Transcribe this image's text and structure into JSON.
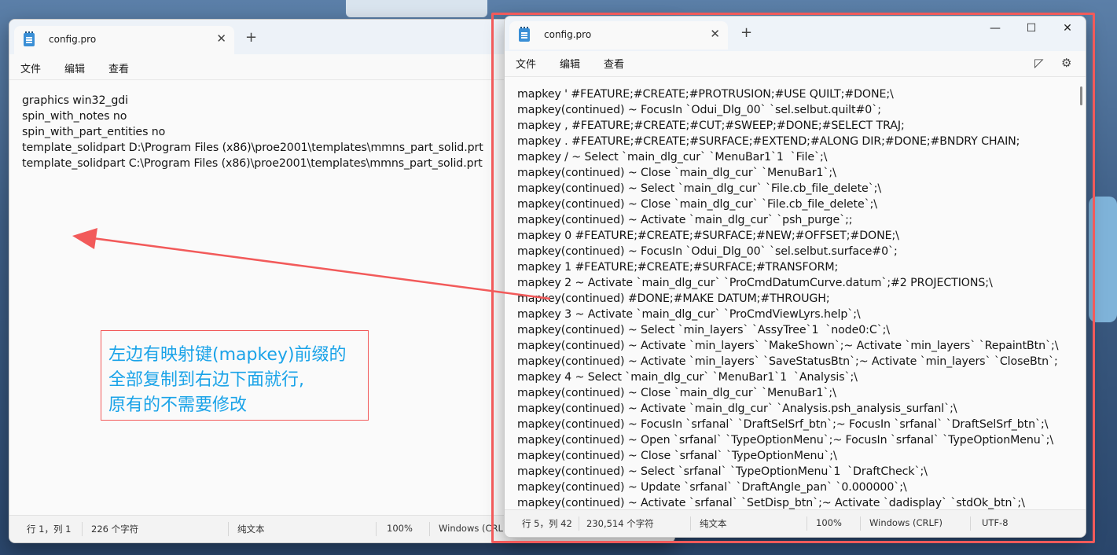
{
  "left_window": {
    "tab_title": "config.pro",
    "menu": [
      "文件",
      "编辑",
      "查看"
    ],
    "lines": [
      "graphics win32_gdi",
      "spin_with_notes no",
      "spin_with_part_entities no",
      "template_solidpart D:\\Program Files (x86)\\proe2001\\templates\\mmns_part_solid.prt",
      "template_solidpart C:\\Program Files (x86)\\proe2001\\templates\\mmns_part_solid.prt"
    ],
    "status": {
      "position": "行 1，列 1",
      "chars": "226 个字符",
      "format": "纯文本",
      "zoom": "100%",
      "line_ending": "Windows (CRLF)"
    }
  },
  "right_window": {
    "tab_title": "config.pro",
    "menu": [
      "文件",
      "编辑",
      "查看"
    ],
    "lines": [
      "mapkey ' #FEATURE;#CREATE;#PROTRUSION;#USE QUILT;#DONE;\\",
      "mapkey(continued) ~ FocusIn `Odui_Dlg_00` `sel.selbut.quilt#0`;",
      "mapkey , #FEATURE;#CREATE;#CUT;#SWEEP;#DONE;#SELECT TRAJ;",
      "mapkey . #FEATURE;#CREATE;#SURFACE;#EXTEND;#ALONG DIR;#DONE;#BNDRY CHAIN;",
      "mapkey / ~ Select `main_dlg_cur` `MenuBar1`1  `File`;\\",
      "mapkey(continued) ~ Close `main_dlg_cur` `MenuBar1`;\\",
      "mapkey(continued) ~ Select `main_dlg_cur` `File.cb_file_delete`;\\",
      "mapkey(continued) ~ Close `main_dlg_cur` `File.cb_file_delete`;\\",
      "mapkey(continued) ~ Activate `main_dlg_cur` `psh_purge`;;",
      "mapkey 0 #FEATURE;#CREATE;#SURFACE;#NEW;#OFFSET;#DONE;\\",
      "mapkey(continued) ~ FocusIn `Odui_Dlg_00` `sel.selbut.surface#0`;",
      "mapkey 1 #FEATURE;#CREATE;#SURFACE;#TRANSFORM;",
      "mapkey 2 ~ Activate `main_dlg_cur` `ProCmdDatumCurve.datum`;#2 PROJECTIONS;\\",
      "mapkey(continued) #DONE;#MAKE DATUM;#THROUGH;",
      "mapkey 3 ~ Activate `main_dlg_cur` `ProCmdViewLyrs.help`;\\",
      "mapkey(continued) ~ Select `min_layers` `AssyTree`1  `node0:C`;\\",
      "mapkey(continued) ~ Activate `min_layers` `MakeShown`;~ Activate `min_layers` `RepaintBtn`;\\",
      "mapkey(continued) ~ Activate `min_layers` `SaveStatusBtn`;~ Activate `min_layers` `CloseBtn`;",
      "mapkey 4 ~ Select `main_dlg_cur` `MenuBar1`1  `Analysis`;\\",
      "mapkey(continued) ~ Close `main_dlg_cur` `MenuBar1`;\\",
      "mapkey(continued) ~ Activate `main_dlg_cur` `Analysis.psh_analysis_surfanl`;\\",
      "mapkey(continued) ~ FocusIn `srfanal` `DraftSelSrf_btn`;~ FocusIn `srfanal` `DraftSelSrf_btn`;\\",
      "mapkey(continued) ~ Open `srfanal` `TypeOptionMenu`;~ FocusIn `srfanal` `TypeOptionMenu`;\\",
      "mapkey(continued) ~ Close `srfanal` `TypeOptionMenu`;\\",
      "mapkey(continued) ~ Select `srfanal` `TypeOptionMenu`1  `DraftCheck`;\\",
      "mapkey(continued) ~ Update `srfanal` `DraftAngle_pan` `0.000000`;\\",
      "mapkey(continued) ~ Activate `srfanal` `SetDisp_btn`;~ Activate `dadisplay` `stdOk_btn`;\\"
    ],
    "status": {
      "position": "行 5，列 42",
      "chars": "230,514 个字符",
      "format": "纯文本",
      "zoom": "100%",
      "line_ending": "Windows (CRLF)",
      "encoding": "UTF-8"
    }
  },
  "annotation": {
    "lines": [
      "左边有映射键(mapkey)前缀的",
      "全部复制到右边下面就行,",
      "原有的不需要修改"
    ],
    "color": "#1aa3e8",
    "border_color": "#f25a5a"
  }
}
